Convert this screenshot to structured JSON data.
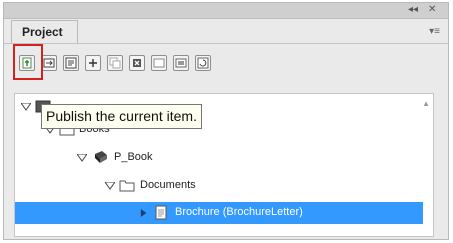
{
  "titlebar": {
    "collapse_glyph": "◂◂",
    "close_glyph": "✕"
  },
  "panel": {
    "tab_label": "Project",
    "menu_glyph": "▾≡"
  },
  "toolbar": {
    "buttons": [
      {
        "name": "publish-button",
        "icon": "publish-icon"
      },
      {
        "name": "import-button",
        "icon": "import-icon"
      },
      {
        "name": "properties-button",
        "icon": "properties-icon"
      },
      {
        "name": "add-button",
        "icon": "add-icon"
      },
      {
        "name": "copy-button",
        "icon": "copy-icon"
      },
      {
        "name": "delete-button",
        "icon": "delete-icon"
      },
      {
        "name": "layout-button",
        "icon": "layout-icon"
      },
      {
        "name": "preview-button",
        "icon": "preview-icon"
      },
      {
        "name": "refresh-button",
        "icon": "refresh-icon"
      }
    ]
  },
  "tooltip": {
    "text": "Publish the current item."
  },
  "tree": {
    "items": [
      {
        "label": "",
        "icon": "project-icon",
        "expanded": true,
        "level": 0
      },
      {
        "label": "Books",
        "icon": "folder-icon",
        "expanded": true,
        "level": 1
      },
      {
        "label": "P_Book",
        "icon": "book-icon",
        "expanded": true,
        "level": 2
      },
      {
        "label": "Documents",
        "icon": "folder-icon",
        "expanded": true,
        "level": 3
      },
      {
        "label": "Brochure (BrochureLetter)",
        "icon": "document-icon",
        "expanded": false,
        "level": 4,
        "selected": true
      }
    ]
  },
  "colors": {
    "selection": "#3399ff",
    "highlight_box": "#d32020",
    "tooltip_bg": "#fffff0"
  }
}
